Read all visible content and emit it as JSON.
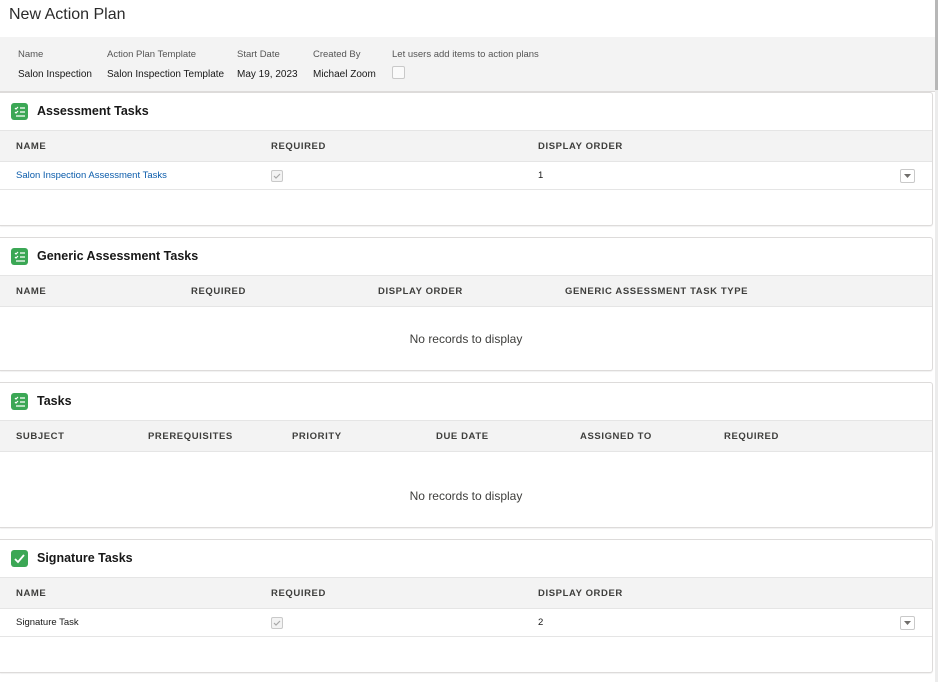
{
  "page": {
    "title": "New Action Plan"
  },
  "summary": {
    "name_label": "Name",
    "name_value": "Salon Inspection",
    "template_label": "Action Plan Template",
    "template_value": "Salon Inspection Template",
    "start_label": "Start Date",
    "start_value": "May 19, 2023",
    "created_label": "Created By",
    "created_value": "Michael Zoom",
    "letusers_label": "Let users add items to action plans",
    "letusers_checked": false
  },
  "assessment": {
    "title": "Assessment Tasks",
    "icon": "checklist-icon",
    "columns": [
      "NAME",
      "REQUIRED",
      "DISPLAY ORDER"
    ],
    "rows": [
      {
        "name": "Salon Inspection Assessment Tasks",
        "required": true,
        "display_order": "1"
      }
    ]
  },
  "generic": {
    "title": "Generic Assessment Tasks",
    "icon": "checklist-icon",
    "columns": [
      "NAME",
      "REQUIRED",
      "DISPLAY ORDER",
      "GENERIC ASSESSMENT TASK TYPE"
    ],
    "empty": "No records to display"
  },
  "tasks": {
    "title": "Tasks",
    "icon": "checklist-icon",
    "columns": [
      "SUBJECT",
      "PREREQUISITES",
      "PRIORITY",
      "DUE DATE",
      "ASSIGNED TO",
      "REQUIRED"
    ],
    "empty": "No records to display"
  },
  "signature": {
    "title": "Signature Tasks",
    "icon": "checkmark-icon",
    "columns": [
      "NAME",
      "REQUIRED",
      "DISPLAY ORDER"
    ],
    "rows": [
      {
        "name": "Signature Task",
        "required": true,
        "display_order": "2"
      }
    ]
  },
  "colors": {
    "icon_bg": "#3ba755",
    "link": "#0b5cab",
    "header_bg": "#f3f3f3"
  }
}
